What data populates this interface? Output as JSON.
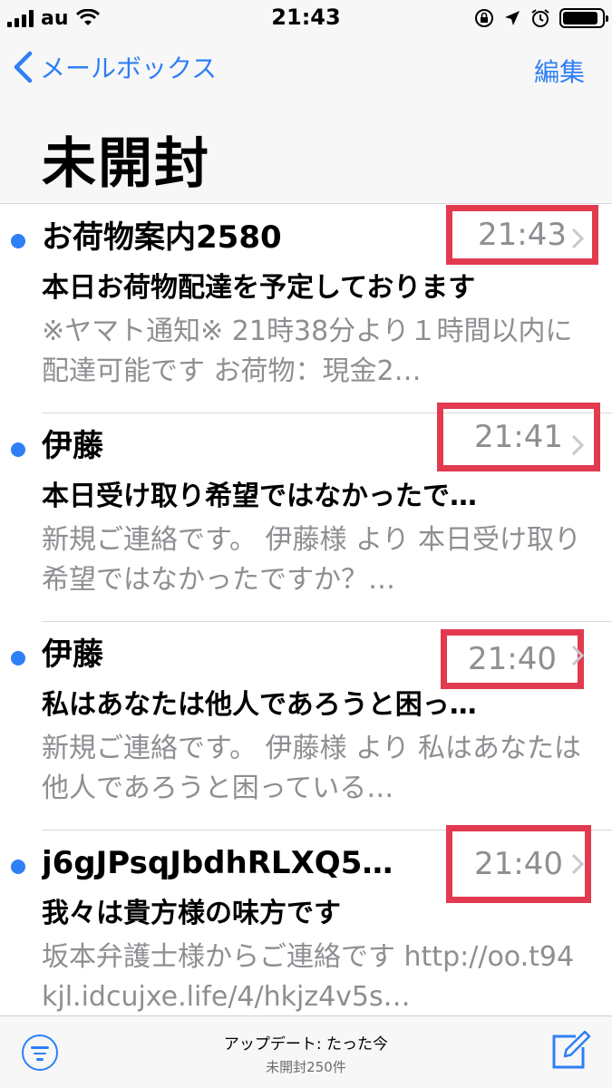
{
  "status": {
    "carrier": "au",
    "time": "21:43",
    "battery_level": 0.9
  },
  "header": {
    "back_label": "メールボックス",
    "edit_label": "編集",
    "title": "未開封"
  },
  "mails": [
    {
      "sender": "お荷物案内2580",
      "time": "21:43",
      "subject": "本日お荷物配達を予定しております",
      "preview": "※ヤマト通知※ 21時38分より１時間以内に配達可能です お荷物：現金2…"
    },
    {
      "sender": "伊藤",
      "time": "21:41",
      "subject": "本日受け取り希望ではなかったで…",
      "preview": "新規ご連絡です。 伊藤様 より 本日受け取り希望ではなかったですか？…"
    },
    {
      "sender": "伊藤",
      "time": "21:40",
      "subject": "私はあなたは他人であろうと困っ…",
      "preview": "新規ご連絡です。 伊藤様 より 私はあなたは他人であろうと困っている…"
    },
    {
      "sender": "j6gJPsqJbdhRLXQ5…",
      "time": "21:40",
      "subject": "我々は貴方様の味方です",
      "preview": "坂本弁護士様からご連絡です http://oo.t94kjl.idcujxe.life/4/hkjz4v5s…"
    }
  ],
  "toolbar": {
    "update": "アップデート: たった今",
    "count": "未開封250件"
  },
  "colors": {
    "accent": "#2f7ff5",
    "highlight_box": "#e23a4f",
    "secondary_text": "#8e8e93"
  },
  "icons": [
    "signal-icon",
    "wifi-icon",
    "lock-rotation-icon",
    "location-icon",
    "alarm-icon",
    "battery-icon",
    "chevron-left-icon",
    "chevron-right-icon",
    "filter-icon",
    "compose-icon"
  ]
}
